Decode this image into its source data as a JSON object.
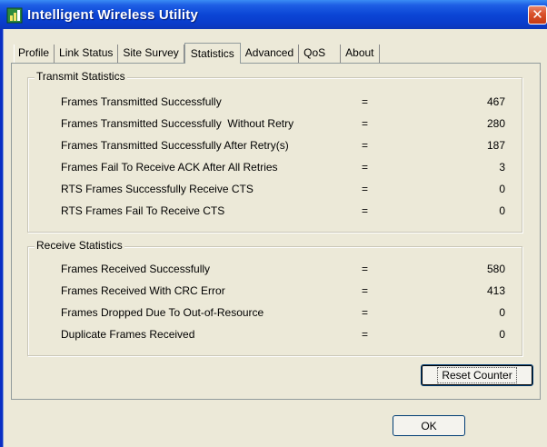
{
  "window": {
    "title": "Intelligent Wireless Utility",
    "close_symbol": "✕",
    "app_icon": "wireless-network-icon",
    "close_icon": "close-icon"
  },
  "tabs": [
    {
      "label": "Profile",
      "active": false
    },
    {
      "label": "Link Status",
      "active": false
    },
    {
      "label": "Site Survey",
      "active": false
    },
    {
      "label": "Statistics",
      "active": true
    },
    {
      "label": "Advanced",
      "active": false
    },
    {
      "label": "QoS",
      "active": false
    },
    {
      "label": "About",
      "active": false
    }
  ],
  "transmit": {
    "title": "Transmit Statistics",
    "rows": [
      {
        "label": "Frames Transmitted Successfully",
        "eq": "=",
        "value": "467"
      },
      {
        "label": "Frames Transmitted Successfully  Without Retry",
        "eq": "=",
        "value": "280"
      },
      {
        "label": "Frames Transmitted Successfully After Retry(s)",
        "eq": "=",
        "value": "187"
      },
      {
        "label": "Frames Fail To Receive ACK After All Retries",
        "eq": "=",
        "value": "3"
      },
      {
        "label": "RTS Frames Successfully Receive CTS",
        "eq": "=",
        "value": "0"
      },
      {
        "label": "RTS Frames Fail To Receive CTS",
        "eq": "=",
        "value": "0"
      }
    ]
  },
  "receive": {
    "title": "Receive Statistics",
    "rows": [
      {
        "label": "Frames Received Successfully",
        "eq": "=",
        "value": "580"
      },
      {
        "label": "Frames Received With CRC Error",
        "eq": "=",
        "value": "413"
      },
      {
        "label": "Frames Dropped Due To Out-of-Resource",
        "eq": "=",
        "value": "0"
      },
      {
        "label": "Duplicate Frames Received",
        "eq": "=",
        "value": "0"
      }
    ]
  },
  "buttons": {
    "reset_counter": "Reset Counter",
    "ok": "OK"
  },
  "colors": {
    "titlebar": "#0a46d6",
    "dialog_face": "#ece9d8",
    "close_button": "#d9512a"
  }
}
